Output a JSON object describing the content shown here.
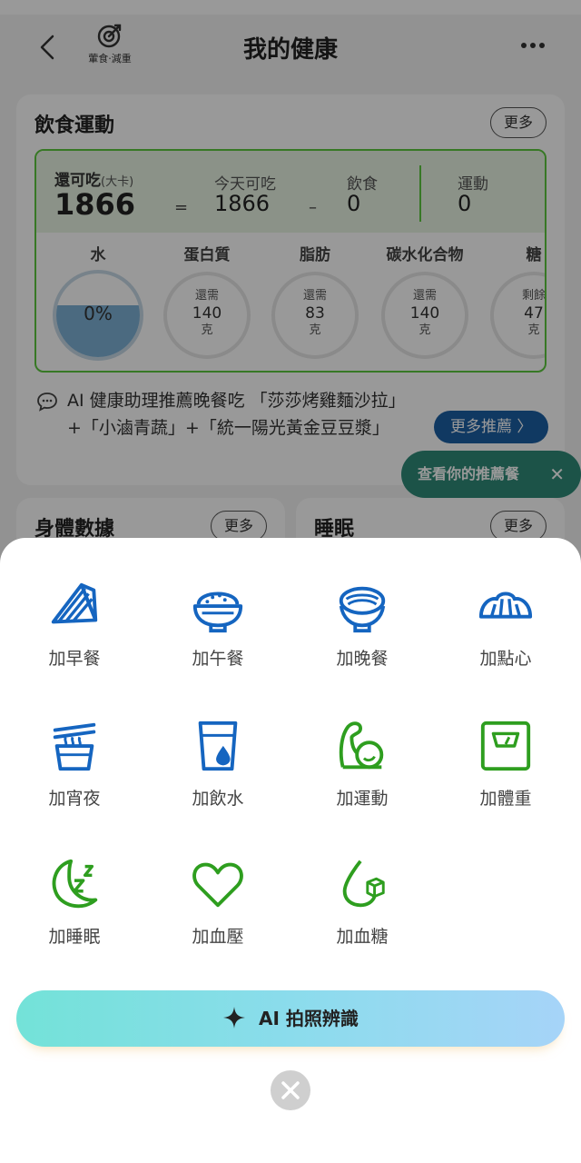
{
  "header": {
    "title": "我的健康",
    "brand_text": "葷食‧減重"
  },
  "diet_card": {
    "title": "飲食運動",
    "more_label": "更多",
    "remaining_label": "還可吃",
    "remaining_unit": "(大卡)",
    "remaining_value": "1866",
    "equals": "=",
    "minus": "–",
    "today_label": "今天可吃",
    "today_value": "1866",
    "food_label": "飲食",
    "food_value": "0",
    "exercise_label": "運動",
    "exercise_value": "0",
    "water": {
      "name": "水",
      "percent_text": "0%"
    },
    "nutrients": [
      {
        "name": "蛋白質",
        "prefix": "還需",
        "amount": "140",
        "unit": "克"
      },
      {
        "name": "脂肪",
        "prefix": "還需",
        "amount": "83",
        "unit": "克"
      },
      {
        "name": "碳水化合物",
        "prefix": "還需",
        "amount": "140",
        "unit": "克"
      },
      {
        "name": "糖",
        "prefix": "剩餘",
        "amount": "47",
        "unit": "克"
      }
    ],
    "ai_tip": "AI 健康助理推薦晚餐吃 「莎莎烤雞麵沙拉」+「小滷青蔬」+「統一陽光黃金豆豆漿」",
    "more_rec_label": "更多推薦 〉",
    "tooltip_label": "查看你的推薦餐",
    "tooltip_close": "✕"
  },
  "body_card": {
    "title": "身體數據",
    "more_label": "更多"
  },
  "sleep_card": {
    "title": "睡眠",
    "more_label": "更多"
  },
  "sheet": {
    "items": [
      {
        "label": "加早餐",
        "icon": "sandwich-icon"
      },
      {
        "label": "加午餐",
        "icon": "rice-bowl-icon"
      },
      {
        "label": "加晚餐",
        "icon": "noodle-bowl-icon"
      },
      {
        "label": "加點心",
        "icon": "croissant-icon"
      },
      {
        "label": "加宵夜",
        "icon": "noodle-cup-icon"
      },
      {
        "label": "加飲水",
        "icon": "water-glass-icon"
      },
      {
        "label": "加運動",
        "icon": "muscle-icon"
      },
      {
        "label": "加體重",
        "icon": "scale-icon"
      },
      {
        "label": "加睡眠",
        "icon": "moon-sleep-icon"
      },
      {
        "label": "加血壓",
        "icon": "heart-icon"
      },
      {
        "label": "加血糖",
        "icon": "drop-cube-icon"
      }
    ],
    "ai_button_label": "AI 拍照辨識"
  },
  "colors": {
    "blue": "#1565c0",
    "green": "#2e9e1f",
    "summary_border": "#5cc93e",
    "tooltip": "#2f8a79"
  }
}
